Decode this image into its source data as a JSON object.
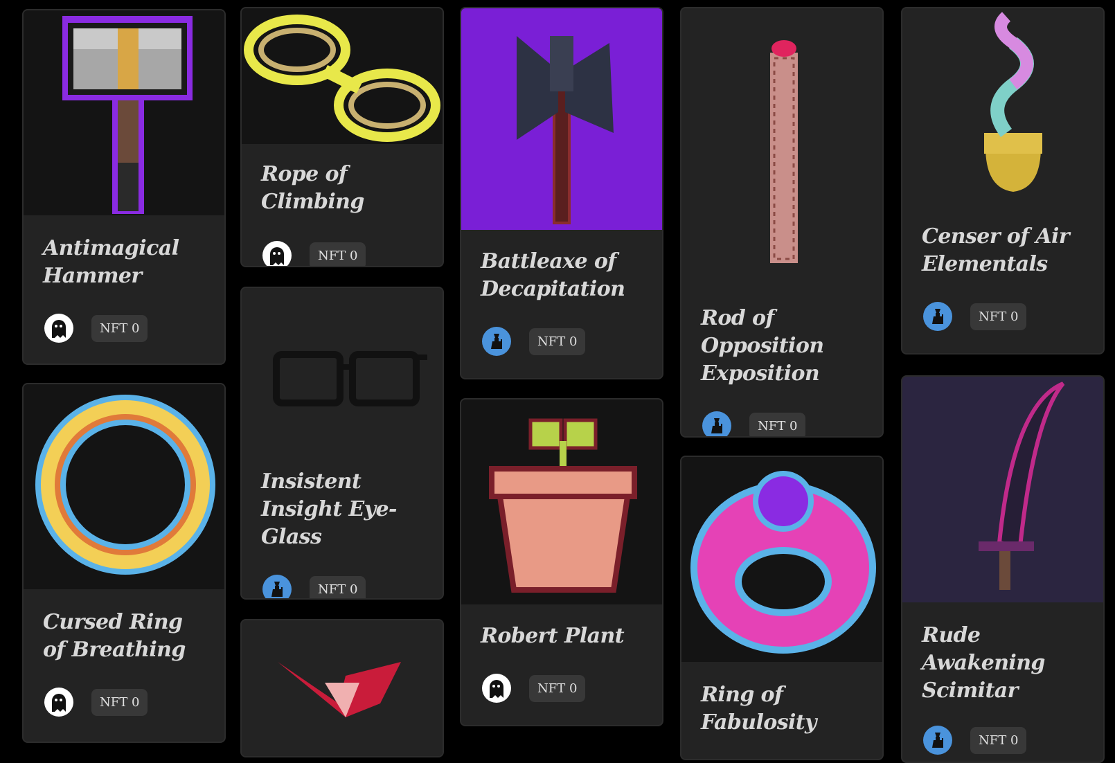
{
  "cards": [
    {
      "name": "Antimagical Hammer",
      "badge": "NFT 0"
    },
    {
      "name": "Rope of Climbing",
      "badge": "NFT 0"
    },
    {
      "name": "Battleaxe of Decapitation",
      "badge": "NFT 0"
    },
    {
      "name": "Rod of Opposition Exposition",
      "badge": "NFT 0"
    },
    {
      "name": "Censer of Air Elementals",
      "badge": "NFT 0"
    },
    {
      "name": "Cursed Ring of Breathing",
      "badge": "NFT 0"
    },
    {
      "name": "Insistent Insight Eye-Glass",
      "badge": "NFT 0"
    },
    {
      "name": "Robert Plant",
      "badge": "NFT 0"
    },
    {
      "name": "Ring of Fabulosity",
      "badge": "NFT 0"
    },
    {
      "name": "Rude Awakening Scimitar",
      "badge": "NFT 0"
    },
    {
      "name": "",
      "badge": ""
    }
  ],
  "colors": {
    "background": "#000000",
    "card": "#232323",
    "badge": "#383838",
    "wizard_avatar": "#4a93dc"
  },
  "icons": {
    "ghost": "ghost-icon",
    "wizard": "wizard-icon"
  }
}
